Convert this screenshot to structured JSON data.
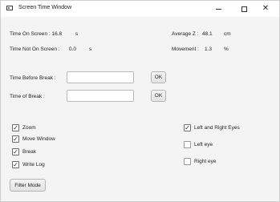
{
  "window": {
    "title": "Screen Time Window",
    "minimize_label": "",
    "maximize_label": "",
    "close_label": "✕"
  },
  "stats": {
    "time_on_screen_label": "Time On Screen : 16.8",
    "time_on_screen_unit": "s",
    "time_not_on_screen_label": "Time Not On Screen :",
    "time_not_on_screen_value": "0.0",
    "time_not_on_screen_unit": "s",
    "average_z_label": "Average Z :",
    "average_z_value": "48.1",
    "average_z_unit": "cm",
    "movement_label": "Movement :",
    "movement_value": "1.3",
    "movement_unit": "%"
  },
  "inputs": {
    "time_before_break_label": "Time Before Break :",
    "time_before_break_value": "",
    "time_of_break_label": "Time of Break :",
    "time_of_break_value": "",
    "ok_label": "OK"
  },
  "options": [
    {
      "label": "Zoom",
      "checked": true
    },
    {
      "label": "Move Window",
      "checked": true
    },
    {
      "label": "Break",
      "checked": true
    },
    {
      "label": "Write Log",
      "checked": true
    }
  ],
  "eyes": [
    {
      "label": "Left and Right Eyes",
      "checked": true
    },
    {
      "label": "Left eye",
      "checked": false
    },
    {
      "label": "Right eye",
      "checked": false
    }
  ],
  "filter_mode_label": "Filter Mode"
}
